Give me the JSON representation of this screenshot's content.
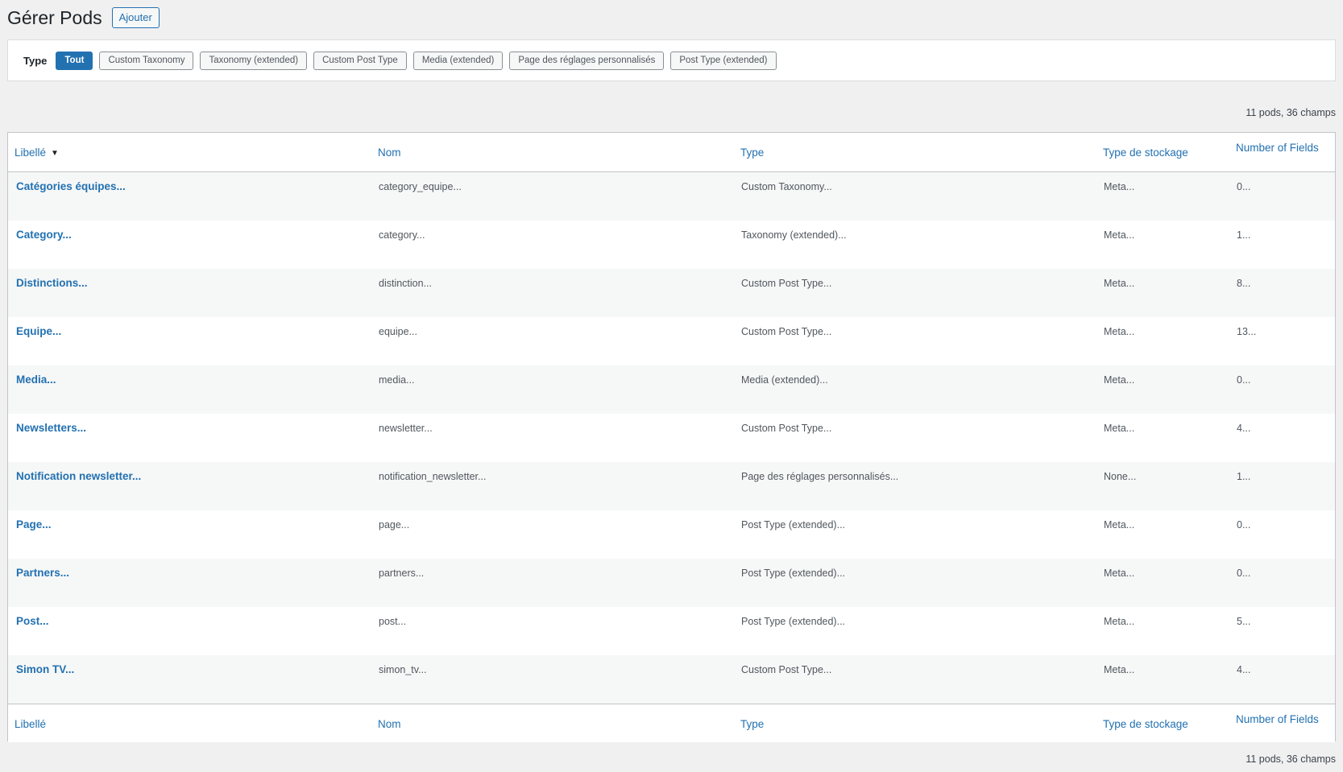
{
  "header": {
    "title": "Gérer Pods",
    "add_label": "Ajouter"
  },
  "filter": {
    "label": "Type",
    "buttons": [
      "Tout",
      "Custom Taxonomy",
      "Taxonomy (extended)",
      "Custom Post Type",
      "Media (extended)",
      "Page des réglages personnalisés",
      "Post Type (extended)"
    ],
    "active": "Tout"
  },
  "summary": "11 pods, 36 champs",
  "columns": [
    "Libellé",
    "Nom",
    "Type",
    "Type de stockage",
    "Number of Fields"
  ],
  "sort_indicator": "▼",
  "rows": [
    [
      "Catégories équipes...",
      "category_equipe...",
      "Custom Taxonomy...",
      "Meta...",
      "0..."
    ],
    [
      "Category...",
      "category...",
      "Taxonomy (extended)...",
      "Meta...",
      "1..."
    ],
    [
      "Distinctions...",
      "distinction...",
      "Custom Post Type...",
      "Meta...",
      "8..."
    ],
    [
      "Equipe...",
      "equipe...",
      "Custom Post Type...",
      "Meta...",
      "13..."
    ],
    [
      "Media...",
      "media...",
      "Media (extended)...",
      "Meta...",
      "0..."
    ],
    [
      "Newsletters...",
      "newsletter...",
      "Custom Post Type...",
      "Meta...",
      "4..."
    ],
    [
      "Notification newsletter...",
      "notification_newsletter...",
      "Page des réglages personnalisés...",
      "None...",
      "1..."
    ],
    [
      "Page...",
      "page...",
      "Post Type (extended)...",
      "Meta...",
      "0..."
    ],
    [
      "Partners...",
      "partners...",
      "Post Type (extended)...",
      "Meta...",
      "0..."
    ],
    [
      "Post...",
      "post...",
      "Post Type (extended)...",
      "Meta...",
      "5..."
    ],
    [
      "Simon TV...",
      "simon_tv...",
      "Custom Post Type...",
      "Meta...",
      "4..."
    ]
  ],
  "colors": {
    "accent": "#2271b1",
    "background": "#f0f0f1",
    "row_alt": "#f6f7f7"
  }
}
